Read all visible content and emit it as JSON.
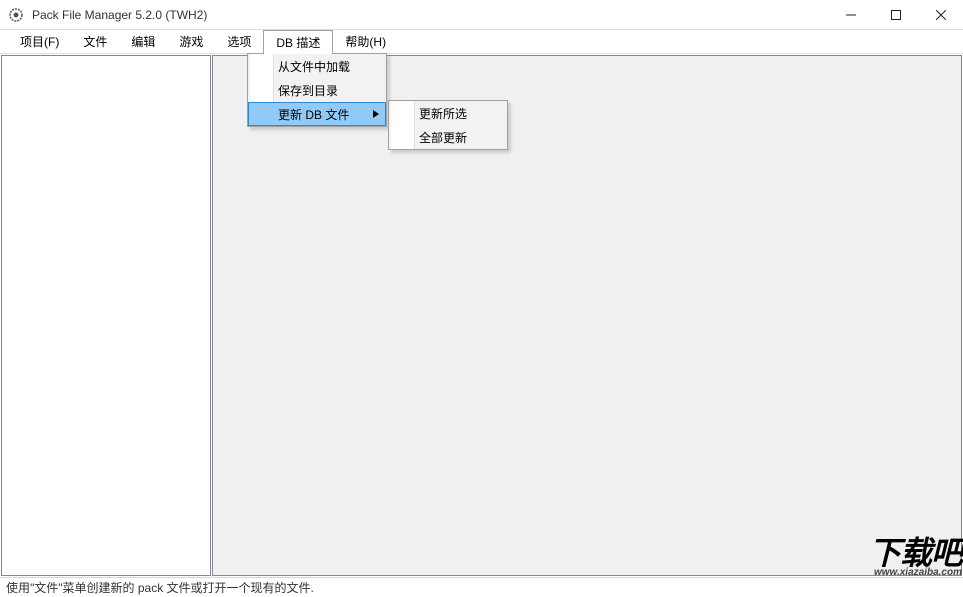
{
  "window": {
    "title": "Pack File Manager 5.2.0 (TWH2)"
  },
  "menubar": {
    "items": [
      {
        "label": "项目(F)"
      },
      {
        "label": "文件"
      },
      {
        "label": "编辑"
      },
      {
        "label": "游戏"
      },
      {
        "label": "选项"
      },
      {
        "label": "DB 描述"
      },
      {
        "label": "帮助(H)"
      }
    ]
  },
  "dropdown_db": {
    "items": [
      {
        "label": "从文件中加载"
      },
      {
        "label": "保存到目录"
      },
      {
        "label": "更新 DB 文件",
        "has_submenu": true,
        "highlighted": true
      }
    ]
  },
  "dropdown_update": {
    "items": [
      {
        "label": "更新所选"
      },
      {
        "label": "全部更新"
      }
    ]
  },
  "statusbar": {
    "text": "使用\"文件\"菜单创建新的 pack 文件或打开一个现有的文件."
  },
  "watermark": {
    "brand": "下载吧",
    "url": "www.xiazaiba.com"
  }
}
